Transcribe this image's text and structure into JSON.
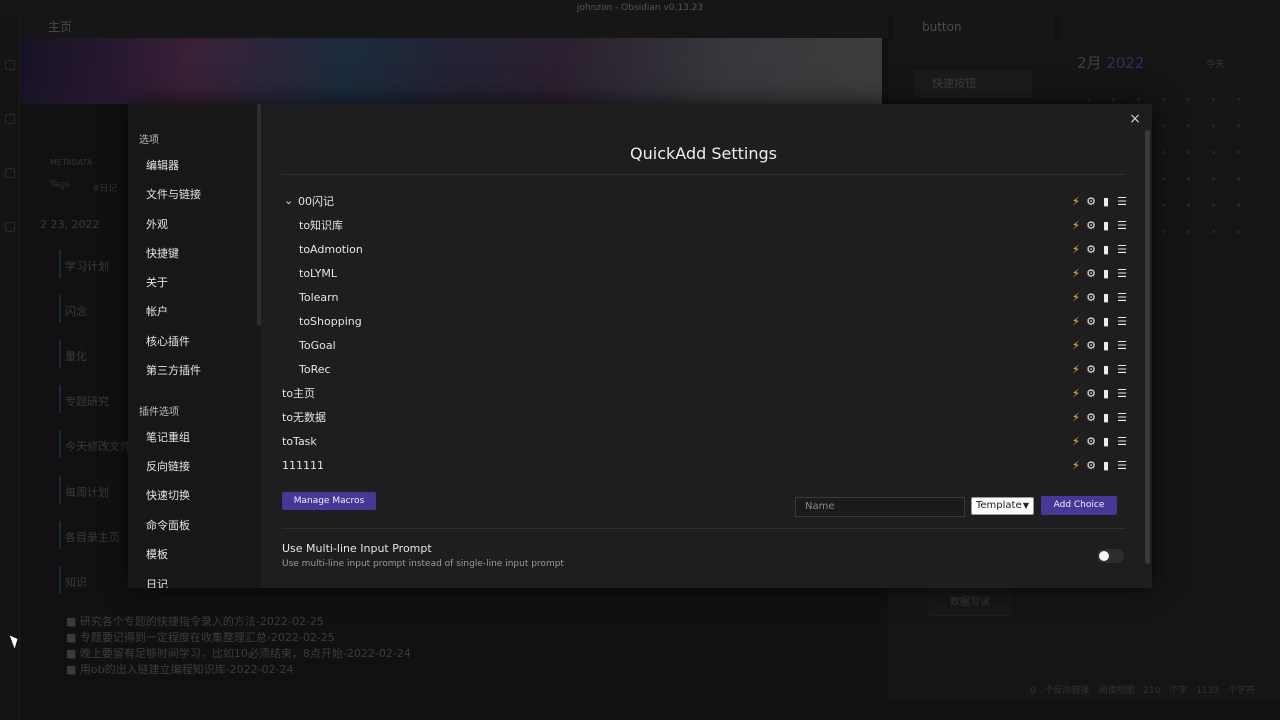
{
  "window": {
    "title": "johnzon - Obsidian v0.13.23"
  },
  "background": {
    "main_tab": "主页",
    "side_tab": "button",
    "banner_metadata": "METADATA",
    "tags_label": "Tags",
    "tag_value": "#日记",
    "date": "2 23, 2022",
    "nav_items": [
      "学习计划",
      "闪念",
      "量化",
      "专题研究",
      "今天修改文件",
      "每周计划",
      "各目录主页",
      "知识"
    ],
    "tasks": [
      "研究各个专题的快捷指令录入的方法-2022-02-25",
      "专题要记得到一定程度在收集整理汇总-2022-02-25",
      "晚上要留有足够时间学习，比如10必须结束，8点开始-2022-02-24",
      "用ob的出入链建立编程知识库-2022-02-24"
    ],
    "quick_button": "快速按钮",
    "calendar_month": "2月",
    "calendar_year": "2022",
    "calendar_today": "今天",
    "bottom_button": "数据写读",
    "status": "0 个反向链接  阅读视图  210 个字  1133 个字符"
  },
  "settings_sidebar": {
    "section_options": "选项",
    "options": [
      "编辑器",
      "文件与链接",
      "外观",
      "快捷键",
      "关于",
      "帐户",
      "核心插件",
      "第三方插件"
    ],
    "section_plugins": "插件选项",
    "plugins": [
      "笔记重组",
      "反向链接",
      "快速切换",
      "命令面板",
      "模板",
      "日记"
    ]
  },
  "quickadd": {
    "title": "QuickAdd Settings",
    "close_icon": "×",
    "choices": [
      {
        "label": "00闪记",
        "level": 0,
        "folder": true
      },
      {
        "label": "to知识库",
        "level": 1
      },
      {
        "label": "toAdmotion",
        "level": 1
      },
      {
        "label": "toLYML",
        "level": 1
      },
      {
        "label": "Tolearn",
        "level": 1
      },
      {
        "label": "toShopping",
        "level": 1
      },
      {
        "label": "ToGoal",
        "level": 1
      },
      {
        "label": "ToRec",
        "level": 1
      },
      {
        "label": "to主页",
        "level": 0
      },
      {
        "label": "to无数据",
        "level": 0
      },
      {
        "label": "toTask",
        "level": 0
      },
      {
        "label": "111111",
        "level": 0
      }
    ],
    "manage_macros": "Manage Macros",
    "name_placeholder": "Name",
    "type_selected": "Template",
    "add_choice": "Add Choice",
    "setting_name": "Use Multi-line Input Prompt",
    "setting_desc": "Use multi-line input prompt instead of single-line input prompt",
    "multiline_enabled": false
  },
  "colors": {
    "accent": "#483699",
    "bolt": "#ffc92a"
  }
}
